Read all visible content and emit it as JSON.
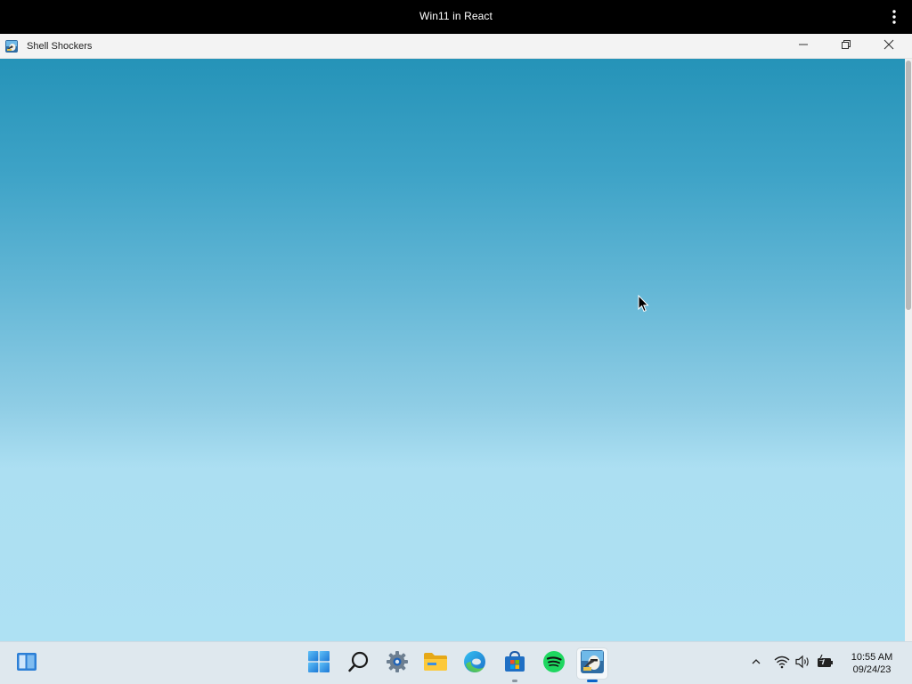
{
  "topbar": {
    "title": "Win11 in React",
    "menu_icon": "kebab-menu-icon"
  },
  "window": {
    "title": "Shell Shockers",
    "app_icon": "shell-shockers-icon",
    "controls": {
      "minimize_icon": "minimize-icon",
      "maximize_icon": "restore-icon",
      "close_icon": "close-icon"
    },
    "content_colors": {
      "top": "#2593b8",
      "bottom": "#aee1f3"
    }
  },
  "taskbar": {
    "widgets_icon": "widgets-icon",
    "pinned": [
      {
        "name": "start",
        "icon": "windows-start-icon"
      },
      {
        "name": "search",
        "icon": "search-icon"
      },
      {
        "name": "settings",
        "icon": "settings-gear-icon"
      },
      {
        "name": "file-explorer",
        "icon": "folder-icon"
      },
      {
        "name": "edge",
        "icon": "edge-browser-icon"
      },
      {
        "name": "store",
        "icon": "microsoft-store-icon"
      },
      {
        "name": "spotify",
        "icon": "spotify-icon"
      },
      {
        "name": "shell-shockers",
        "icon": "shell-shockers-icon",
        "active": true
      }
    ],
    "tray": {
      "chevron_icon": "chevron-up-icon",
      "wifi_icon": "wifi-icon",
      "volume_icon": "volume-icon",
      "battery_icon": "battery-charging-icon"
    },
    "clock": {
      "time": "10:55 AM",
      "date": "09/24/23"
    }
  }
}
